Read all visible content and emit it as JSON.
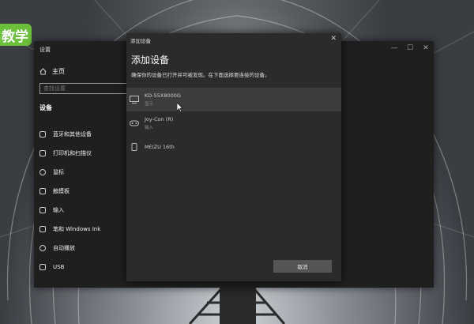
{
  "brand": {
    "text": "教学"
  },
  "settings_window": {
    "title": "设置",
    "controls": {
      "minimize": "—",
      "maximize": "☐",
      "close": "✕"
    },
    "home_label": "主页",
    "search_placeholder": "查找设置",
    "section_label": "设备",
    "nav_items": [
      {
        "label": "蓝牙和其他设备",
        "icon": "bluetooth-devices-icon"
      },
      {
        "label": "打印机和扫描仪",
        "icon": "printer-icon"
      },
      {
        "label": "鼠标",
        "icon": "mouse-icon"
      },
      {
        "label": "触摸板",
        "icon": "touchpad-icon"
      },
      {
        "label": "输入",
        "icon": "keyboard-icon"
      },
      {
        "label": "笔和 Windows Ink",
        "icon": "pen-icon"
      },
      {
        "label": "自动播放",
        "icon": "autoplay-icon"
      },
      {
        "label": "USB",
        "icon": "usb-icon"
      }
    ]
  },
  "dialog": {
    "titlebar": "添加设备",
    "close": "✕",
    "heading": "添加设备",
    "description": "确保你的设备已打开并可被发现。在下面选择要连接的设备。",
    "devices": [
      {
        "name": "KD-55X8000G",
        "status": "显示",
        "icon": "monitor-icon",
        "selected": true
      },
      {
        "name": "Joy-Con (R)",
        "status": "输入",
        "icon": "gamepad-icon",
        "selected": false
      },
      {
        "name": "MEIZU 16th",
        "status": "",
        "icon": "phone-icon",
        "selected": false
      }
    ],
    "cancel_label": "取消"
  }
}
